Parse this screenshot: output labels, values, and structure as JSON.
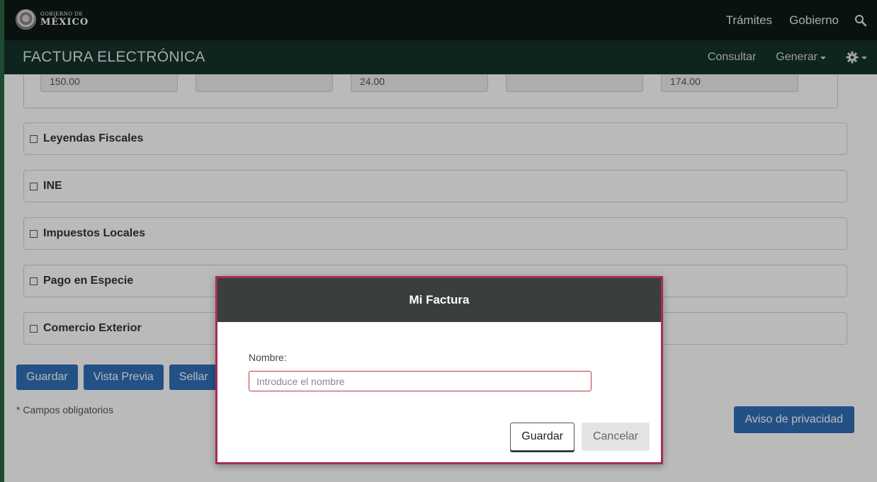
{
  "gov_header": {
    "logo_small": "GOBIERNO DE",
    "logo_big": "MÉXICO",
    "links": [
      "Trámites",
      "Gobierno"
    ],
    "search_icon": "search-icon"
  },
  "app_bar": {
    "title": "FACTURA ELECTRÓNICA",
    "consultar": "Consultar",
    "generar": "Generar",
    "settings_icon": "gear-icon"
  },
  "totals": {
    "values": [
      "150.00",
      "",
      "24.00",
      "",
      "174.00"
    ]
  },
  "panels": [
    {
      "label": "Leyendas Fiscales"
    },
    {
      "label": "INE"
    },
    {
      "label": "Impuestos Locales"
    },
    {
      "label": "Pago en Especie"
    },
    {
      "label": "Comercio Exterior"
    }
  ],
  "actions": {
    "guardar": "Guardar",
    "vista_previa": "Vista Previa",
    "sellar": "Sellar"
  },
  "required_note": "* Campos obligatorios",
  "privacy_button": "Aviso de privacidad",
  "modal": {
    "title": "Mi Factura",
    "field_label": "Nombre:",
    "field_placeholder": "Introduce el nombre",
    "field_value": "",
    "save_button": "Guardar",
    "cancel_button": "Cancelar"
  },
  "colors": {
    "gov_bar": "#0f1a15",
    "app_bar": "#13322b",
    "primary_button": "#3070b8",
    "modal_border": "#a82c56",
    "modal_header": "#3b3e3f"
  }
}
